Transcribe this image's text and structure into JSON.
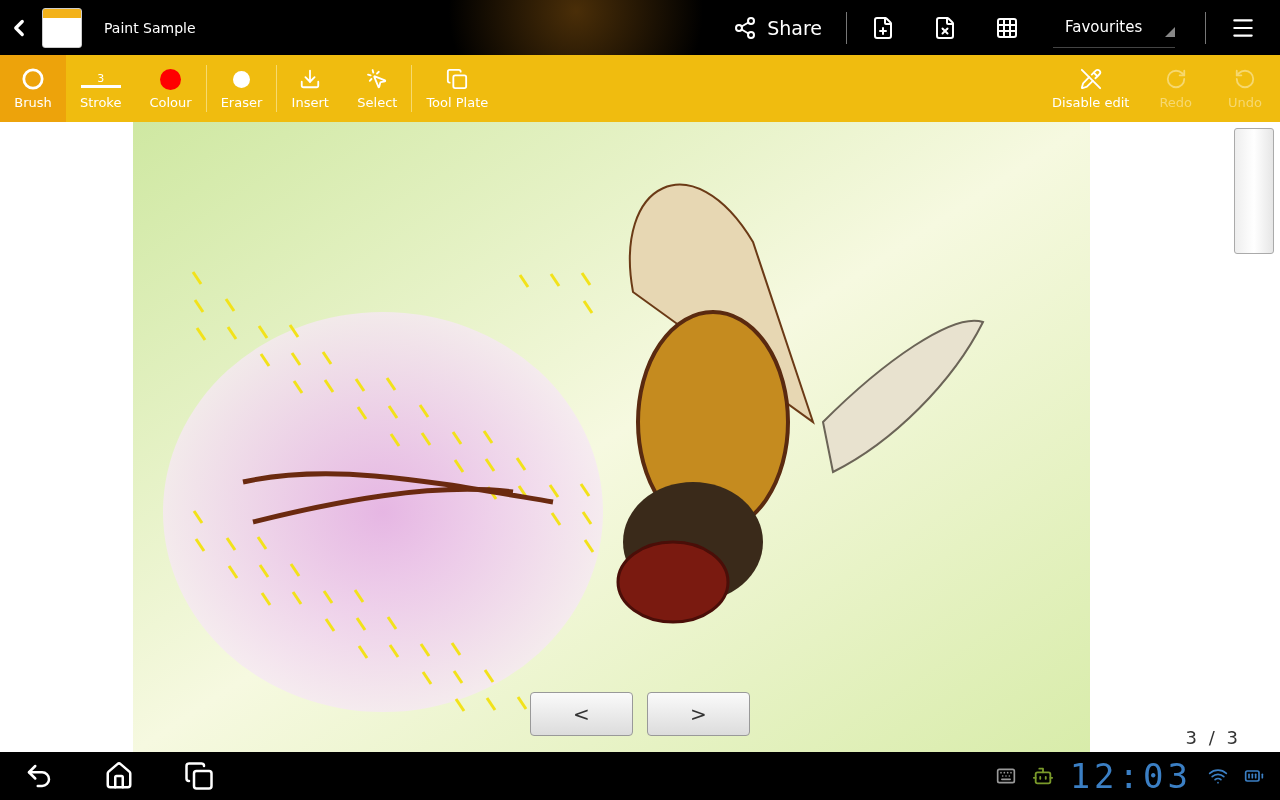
{
  "app_bar": {
    "title": "Paint Sample",
    "category": "Favourites",
    "actions": [
      {
        "kind": "share",
        "label": "Share"
      },
      {
        "kind": "new_page"
      },
      {
        "kind": "delete_page"
      },
      {
        "kind": "grid"
      }
    ]
  },
  "toolbar": {
    "tools": [
      {
        "kind": "brush",
        "label": "Brush",
        "selected": true,
        "divider_after": false
      },
      {
        "kind": "stroke",
        "label": "Stroke",
        "value": "3",
        "selected": false,
        "divider_after": false
      },
      {
        "kind": "colour",
        "label": "Colour",
        "color": "#ff0000",
        "selected": false,
        "divider_after": true
      },
      {
        "kind": "eraser",
        "label": "Eraser",
        "selected": false,
        "divider_after": true
      },
      {
        "kind": "insert",
        "label": "Insert",
        "selected": false,
        "divider_after": false
      },
      {
        "kind": "select",
        "label": "Select",
        "selected": false,
        "divider_after": true
      },
      {
        "kind": "plate",
        "label": "Tool Plate",
        "selected": false,
        "divider_after": false
      }
    ],
    "actions": [
      {
        "kind": "disable_edit",
        "label": "Disable edit",
        "disabled": false
      },
      {
        "kind": "redo",
        "label": "Redo",
        "disabled": true
      },
      {
        "kind": "undo",
        "label": "Undo",
        "disabled": true
      }
    ]
  },
  "pager": {
    "previous": "<",
    "next": ">",
    "counter": "3 / 3"
  },
  "status_bar": {
    "time": "12:03"
  }
}
